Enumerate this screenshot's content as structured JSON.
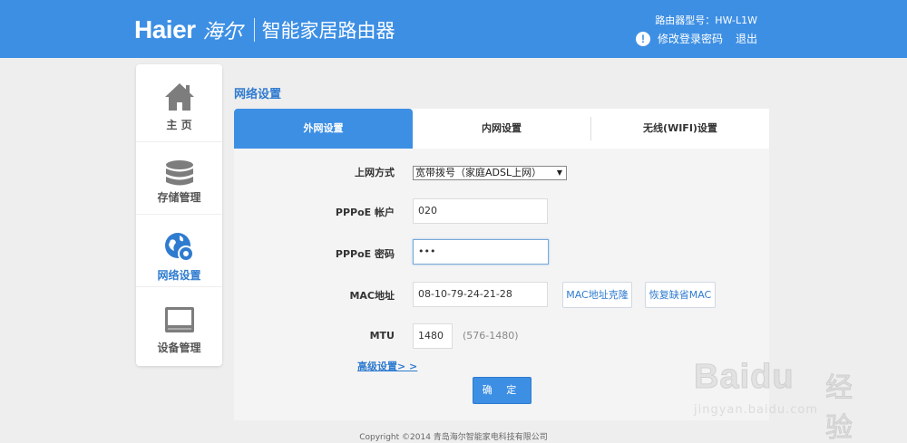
{
  "header": {
    "logo_brand": "Haier",
    "logo_chinese": "海尔",
    "product_name": "智能家居路由器",
    "model_label": "路由器型号：HW-L1W",
    "change_password": "修改登录密码",
    "logout": "退出",
    "accent": "#3d8fe4"
  },
  "sidebar": {
    "items": [
      {
        "label": "主  页",
        "icon": "home-icon",
        "active": false
      },
      {
        "label": "存储管理",
        "icon": "database-icon",
        "active": false
      },
      {
        "label": "网络设置",
        "icon": "network-gear-icon",
        "active": true
      },
      {
        "label": "设备管理",
        "icon": "device-icon",
        "active": false
      }
    ]
  },
  "main": {
    "section_title": "网络设置",
    "tabs": [
      {
        "label": "外网设置",
        "active": true
      },
      {
        "label": "内网设置",
        "active": false
      },
      {
        "label": "无线(WIFI)设置",
        "active": false
      }
    ],
    "form": {
      "conn_type_label": "上网方式",
      "conn_type_value": "宽带拨号（家庭ADSL上网）",
      "pppoe_account_label": "PPPoE 帐户",
      "pppoe_account_value": "020",
      "pppoe_password_label": "PPPoE 密码",
      "pppoe_password_value": "•••",
      "mac_label": "MAC地址",
      "mac_value": "08-10-79-24-21-28",
      "mac_clone_button": "MAC地址克隆",
      "mac_restore_button": "恢复缺省MAC",
      "mtu_label": "MTU",
      "mtu_value": "1480",
      "mtu_hint": "(576-1480)",
      "advanced_link": "高级设置> >",
      "confirm_button": "确 定"
    }
  },
  "footer": {
    "copyright": "Copyright ©2014 青岛海尔智能家电科技有限公司"
  },
  "watermark": {
    "main": "Baidu",
    "cn": "经验",
    "sub": "jingyan.baidu.com"
  }
}
